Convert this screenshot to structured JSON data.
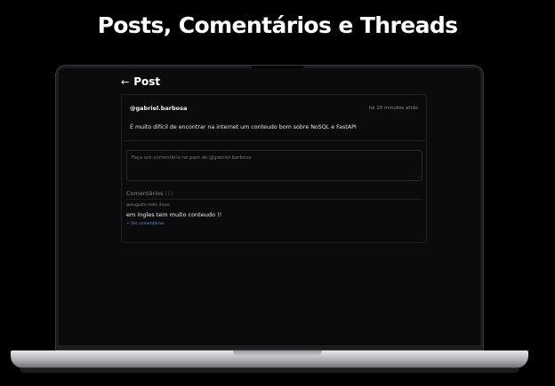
{
  "banner": {
    "title": "Posts, Comentários  e Threads"
  },
  "header": {
    "back_icon": "←",
    "title": "Post"
  },
  "post": {
    "author": "@gabriel.barbosa",
    "time": "há 10 minutos atrás",
    "content": "É muito difícil de encontrar na internet um conteudo bom sobre NoSQL e FastAPI"
  },
  "comment_form": {
    "placeholder": "Faça um comentário no post de @gabriel.barbosa"
  },
  "comments": {
    "heading": "Comentários",
    "count": "(1)",
    "items": [
      {
        "author": "@augusto.melo disse:",
        "text": "em ingles tem muito conteudo !!",
        "view_more": "+ Ver comentários"
      }
    ]
  },
  "icons": {
    "back": "arrow-left-icon"
  },
  "colors": {
    "background": "#000000",
    "screen": "#0b0b0d",
    "link": "#4a9eda"
  }
}
